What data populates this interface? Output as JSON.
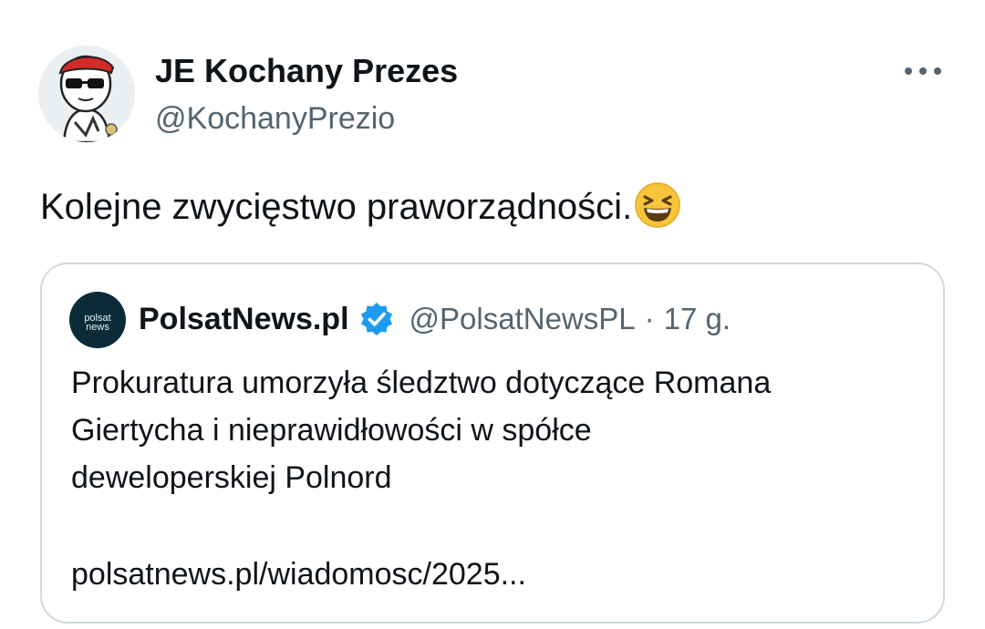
{
  "tweet": {
    "author": {
      "display_name": "JE Kochany Prezes",
      "handle": "@KochanyPrezio",
      "avatar_icon": "cartoon-character-with-sunglasses-avatar"
    },
    "more_icon": "more-horizontal-icon",
    "text": "Kolejne zwycięstwo praworządności.",
    "emoji_icon": "grinning-squinting-face-emoji"
  },
  "quote": {
    "author": {
      "display_name": "PolsatNews.pl",
      "handle": "@PolsatNewsPL",
      "avatar_label_top": "polsat",
      "avatar_label_bottom": "news",
      "verified_icon": "verified-badge-icon"
    },
    "separator": "·",
    "time": "17 g.",
    "text_lines": [
      "Prokuratura umorzyła śledztwo dotyczące Romana",
      "Giertycha i nieprawidłowości w spółce",
      "deweloperskiej Polnord"
    ],
    "link": "polsatnews.pl/wiadomosc/2025..."
  },
  "colors": {
    "primary_text": "#0f1419",
    "secondary_text": "#536471",
    "border": "#cfd9de",
    "verified_blue": "#1d9bf0",
    "polsat_bg": "#0b2b38"
  }
}
